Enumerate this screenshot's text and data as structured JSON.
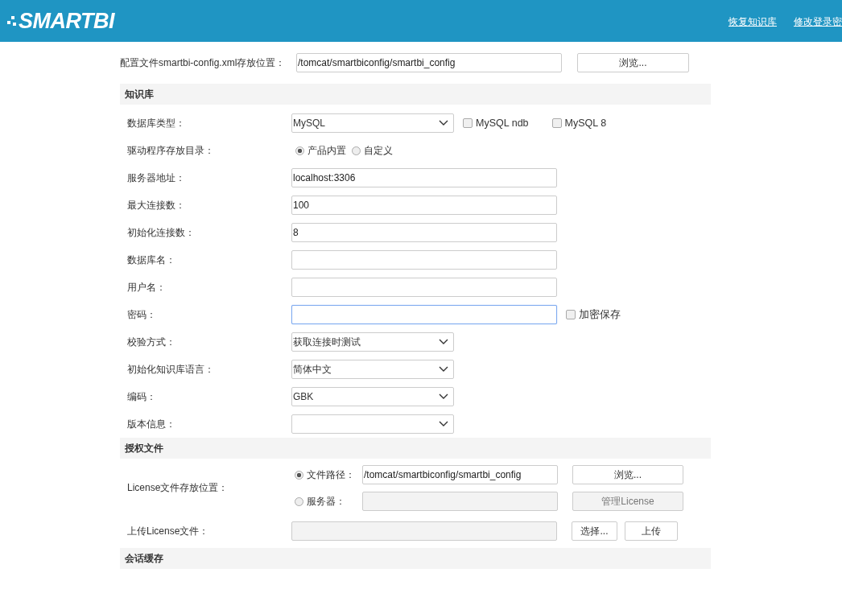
{
  "header": {
    "logo": "SMARTBI",
    "links": [
      "恢复知识库",
      "修改登录密"
    ]
  },
  "config": {
    "label": "配置文件smartbi-config.xml存放位置：",
    "value": "/tomcat/smartbiconfig/smartbi_config",
    "button": "浏览..."
  },
  "knowledge": {
    "title": "知识库",
    "rows": [
      {
        "kind": "select",
        "label": "数据库类型：",
        "value": "MySQL",
        "extras": [
          {
            "label": "MySQL ndb",
            "checked": false
          },
          {
            "label": "MySQL 8",
            "checked": false
          }
        ]
      },
      {
        "kind": "radio",
        "label": "驱动程序存放目录：",
        "options": [
          {
            "label": "产品内置",
            "selected": true
          },
          {
            "label": "自定义",
            "selected": false
          }
        ]
      },
      {
        "kind": "input",
        "label": "服务器地址：",
        "value": "localhost:3306",
        "focused": false
      },
      {
        "kind": "input",
        "label": "最大连接数：",
        "value": "100",
        "focused": false
      },
      {
        "kind": "input",
        "label": "初始化连接数：",
        "value": "8",
        "focused": false
      },
      {
        "kind": "input",
        "label": "数据库名：",
        "focused": false
      },
      {
        "kind": "input",
        "label": "用户名：",
        "focused": false
      },
      {
        "kind": "input",
        "label": "密码：",
        "focused": true,
        "extras": [
          {
            "label": "加密保存",
            "checked": false
          }
        ]
      },
      {
        "kind": "select",
        "label": "校验方式：",
        "value": "获取连接时测试"
      },
      {
        "kind": "select",
        "label": "初始化知识库语言：",
        "value": "简体中文"
      },
      {
        "kind": "select",
        "label": "编码：",
        "value": "GBK"
      },
      {
        "kind": "select",
        "label": "版本信息："
      }
    ]
  },
  "license": {
    "title": "授权文件",
    "label": "License文件存放位置：",
    "options": [
      {
        "label": "文件路径：",
        "selected": true,
        "value": "/tomcat/smartbiconfig/smartbi_config",
        "button": "浏览...",
        "disabled": false
      },
      {
        "label": "服务器：",
        "selected": false,
        "button": "管理License",
        "disabled": true
      }
    ],
    "upload": {
      "label": "上传License文件：",
      "buttons": [
        "选择...",
        "上传"
      ]
    }
  },
  "session": {
    "title": "会话缓存"
  }
}
